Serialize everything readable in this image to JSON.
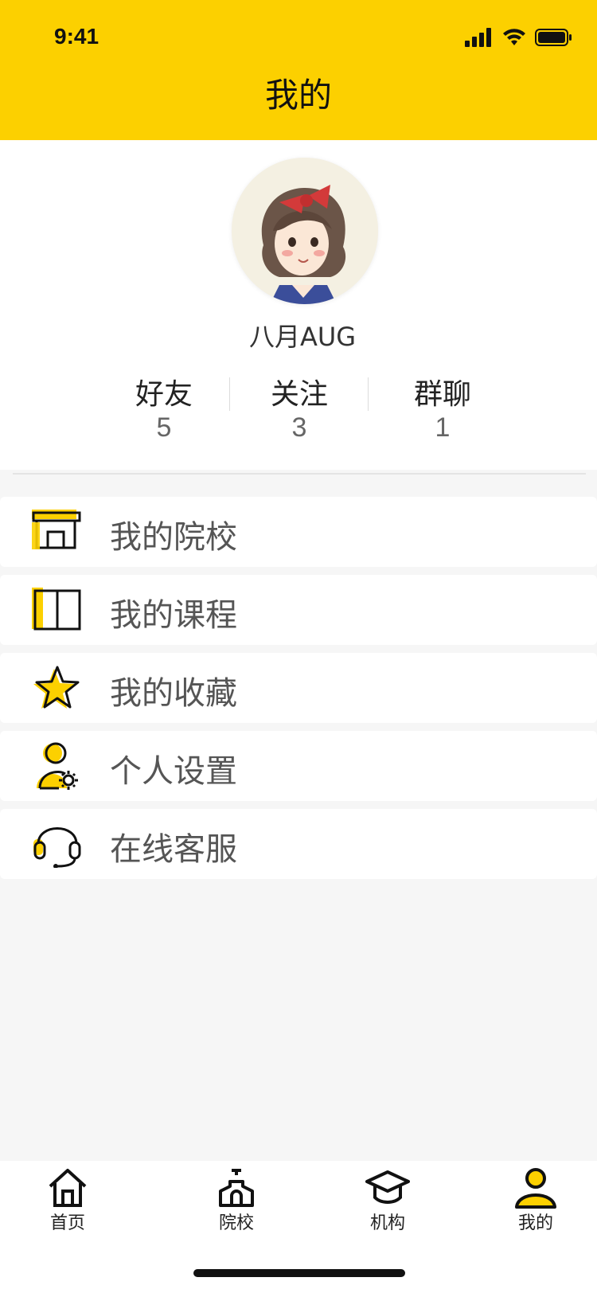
{
  "status_bar": {
    "time": "9:41"
  },
  "header": {
    "title": "我的"
  },
  "profile": {
    "username": "八月AUG",
    "stats": [
      {
        "label": "好友",
        "count": "5"
      },
      {
        "label": "关注",
        "count": "3"
      },
      {
        "label": "群聊",
        "count": "1"
      }
    ]
  },
  "menu": [
    {
      "label": "我的院校",
      "icon": "school-icon"
    },
    {
      "label": "我的课程",
      "icon": "book-icon"
    },
    {
      "label": "我的收藏",
      "icon": "star-icon"
    },
    {
      "label": "个人设置",
      "icon": "user-settings-icon"
    },
    {
      "label": "在线客服",
      "icon": "headset-icon"
    }
  ],
  "tabbar": {
    "items": [
      {
        "label": "首页",
        "icon": "home-icon",
        "active": false
      },
      {
        "label": "院校",
        "icon": "school-tab-icon",
        "active": false
      },
      {
        "label": "机构",
        "icon": "graduation-cap-icon",
        "active": false
      },
      {
        "label": "我的",
        "icon": "profile-icon",
        "active": true
      }
    ]
  },
  "colors": {
    "accent": "#fcd000",
    "background": "#f6f6f6",
    "text": "#222222",
    "muted": "#555555"
  }
}
